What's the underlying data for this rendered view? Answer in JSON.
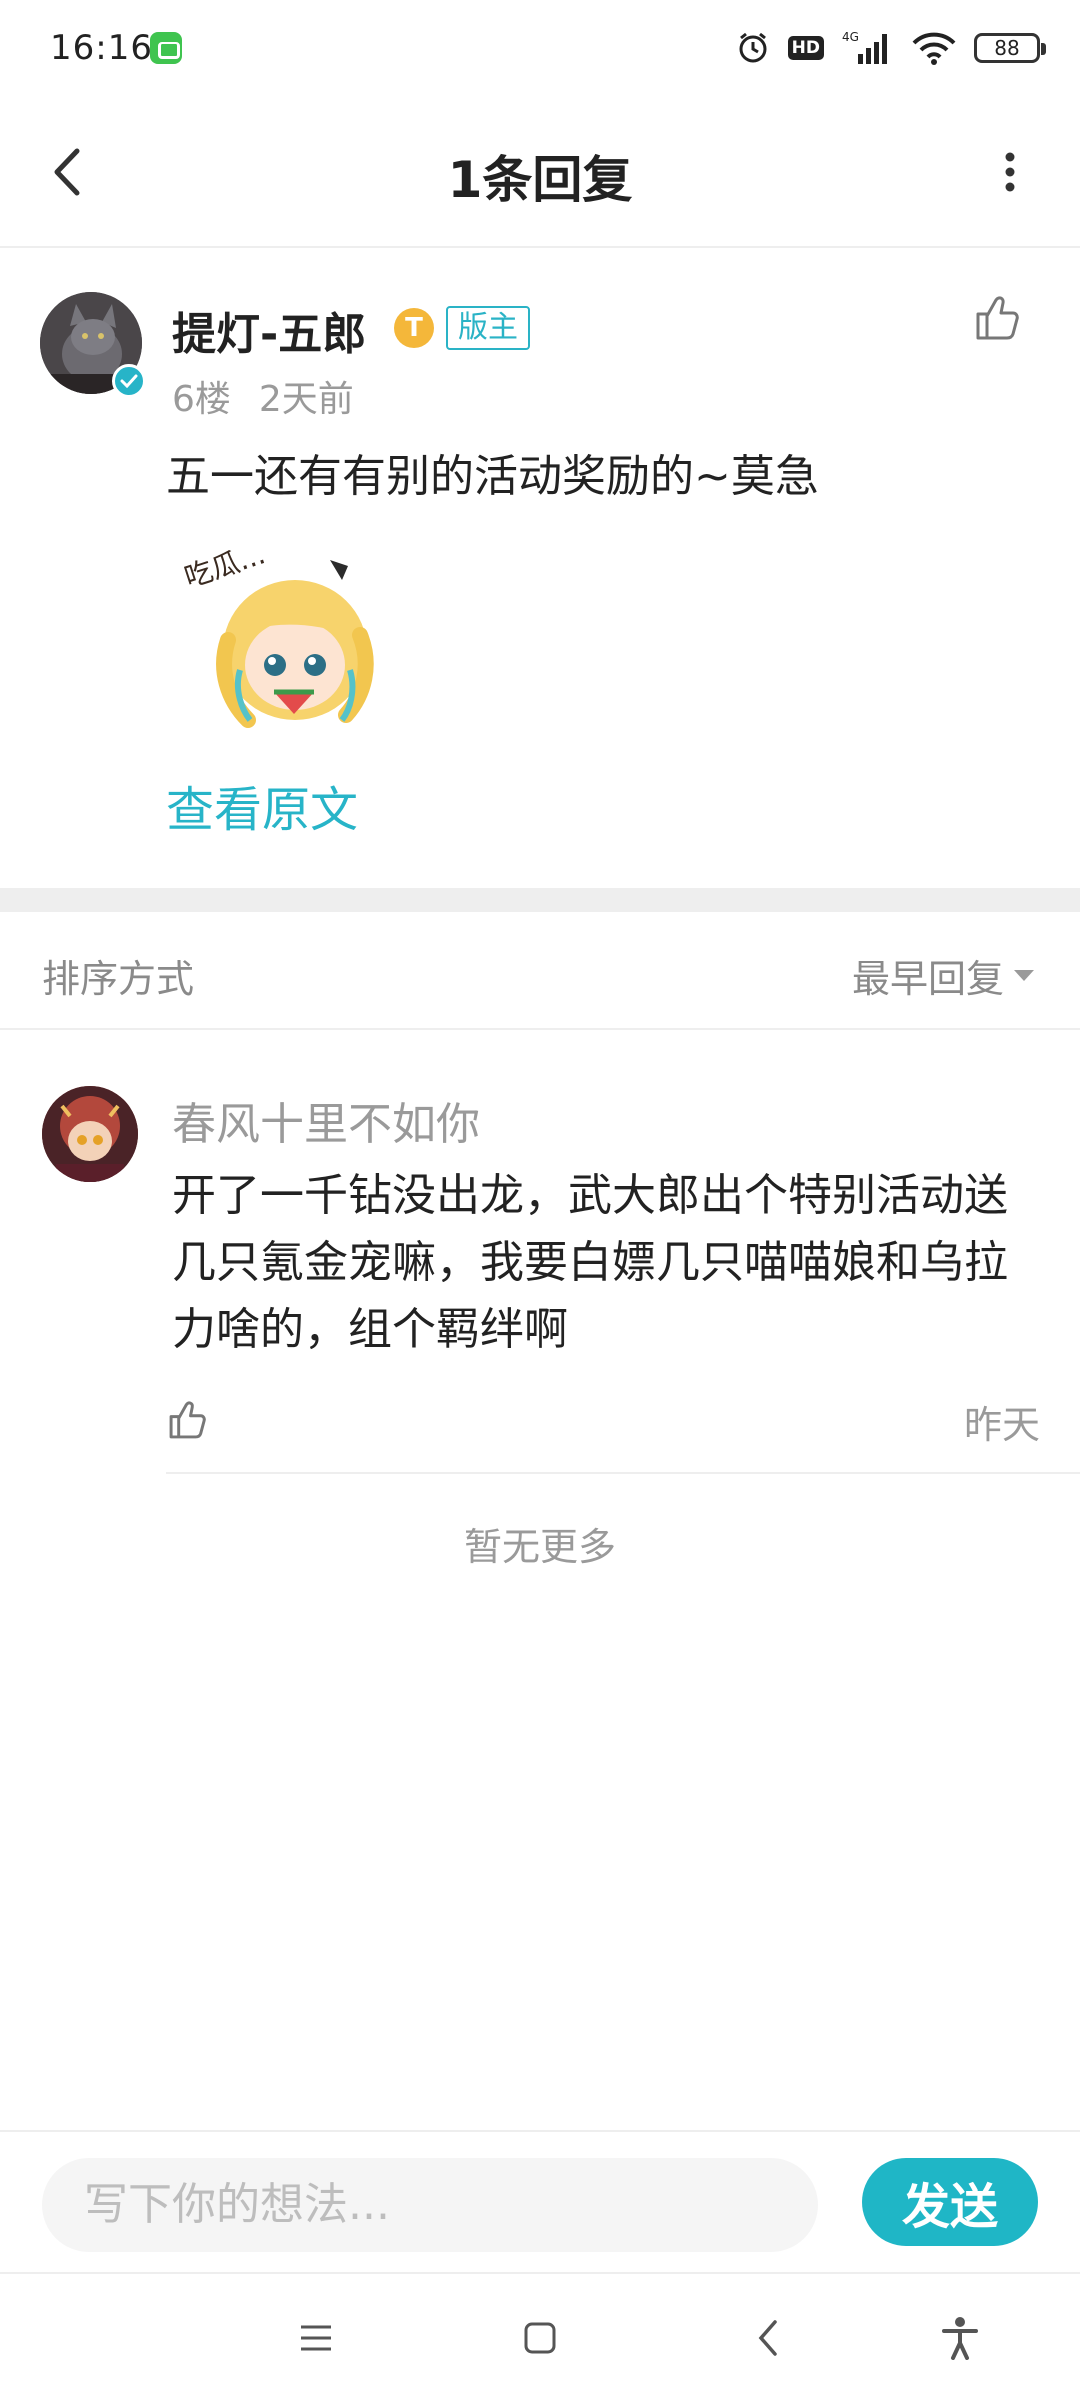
{
  "status_bar": {
    "time": "16:16",
    "hd_label": "HD",
    "network": "4G",
    "battery": "88"
  },
  "header": {
    "title": "1条回复"
  },
  "post": {
    "username": "提灯-五郎",
    "level_icon": "T",
    "role_badge": "版主",
    "floor": "6楼",
    "time": "2天前",
    "text": "五一还有有别的活动奖励的~莫急",
    "view_original": "查看原文"
  },
  "sort": {
    "label": "排序方式",
    "selected": "最早回复"
  },
  "reply": {
    "username": "春风十里不如你",
    "text": "开了一千钻没出龙，武大郎出个特别活动送几只氪金宠嘛，我要白嫖几只喵喵娘和乌拉力啥的，组个羁绊啊",
    "time": "昨天"
  },
  "footer_note": "暂无更多",
  "input": {
    "placeholder": "写下你的想法...",
    "send_label": "发送"
  },
  "colors": {
    "accent": "#1fb6c6",
    "badge_gold": "#f4b73a",
    "text_secondary": "#9a9a9a"
  },
  "icons": [
    "back-icon",
    "more-icon",
    "like-icon",
    "alarm-icon",
    "wifi-icon",
    "signal-icon",
    "battery-icon",
    "menu-icon",
    "home-icon",
    "nav-back-icon",
    "accessibility-icon"
  ]
}
